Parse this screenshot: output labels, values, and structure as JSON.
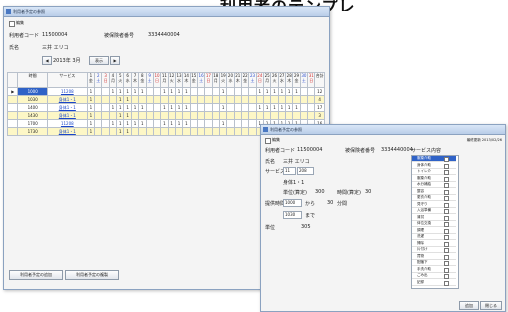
{
  "heading": "利用者のテンプレ",
  "win1": {
    "title": "利用者予定の参照",
    "edit_label": "編集",
    "user_code_label": "利用者コード",
    "user_code": "11500004",
    "insurance_label": "被保険者番号",
    "insurance_no": "3334440004",
    "name_label": "氏名",
    "name": "三井 エリコ",
    "month": "2013年 3月",
    "display_btn": "表示",
    "prev_icon": "chevron-left-icon",
    "next_icon": "chevron-right-icon",
    "col_time": "時間",
    "col_service": "サービス",
    "days": [
      {
        "d": "1",
        "w": "金"
      },
      {
        "d": "2",
        "w": "土"
      },
      {
        "d": "3",
        "w": "日"
      },
      {
        "d": "4",
        "w": "月"
      },
      {
        "d": "5",
        "w": "火"
      },
      {
        "d": "6",
        "w": "水"
      },
      {
        "d": "7",
        "w": "木"
      },
      {
        "d": "8",
        "w": "金"
      },
      {
        "d": "9",
        "w": "土"
      },
      {
        "d": "10",
        "w": "日"
      },
      {
        "d": "11",
        "w": "月"
      },
      {
        "d": "12",
        "w": "火"
      },
      {
        "d": "13",
        "w": "水"
      },
      {
        "d": "14",
        "w": "木"
      },
      {
        "d": "15",
        "w": "金"
      },
      {
        "d": "16",
        "w": "土"
      },
      {
        "d": "17",
        "w": "日"
      },
      {
        "d": "18",
        "w": "月"
      },
      {
        "d": "19",
        "w": "火"
      },
      {
        "d": "20",
        "w": "水"
      },
      {
        "d": "21",
        "w": "木"
      },
      {
        "d": "22",
        "w": "金"
      },
      {
        "d": "23",
        "w": "土"
      },
      {
        "d": "24",
        "w": "日"
      },
      {
        "d": "25",
        "w": "月"
      },
      {
        "d": "26",
        "w": "火"
      },
      {
        "d": "27",
        "w": "水"
      },
      {
        "d": "28",
        "w": "木"
      },
      {
        "d": "29",
        "w": "金"
      },
      {
        "d": "30",
        "w": "土"
      },
      {
        "d": "31",
        "w": "日"
      }
    ],
    "total_col": "合計",
    "rows": [
      {
        "time": "1000",
        "service": "11208",
        "marks": [
          1,
          0,
          0,
          1,
          1,
          1,
          1,
          1,
          0,
          0,
          1,
          1,
          1,
          1,
          0,
          0,
          0,
          0,
          1,
          0,
          0,
          0,
          0,
          1,
          1,
          1,
          1,
          1,
          1,
          0,
          0
        ],
        "total": "12"
      },
      {
        "time": "1030",
        "service": "身体1・1",
        "marks": [
          1,
          0,
          0,
          0,
          1,
          1,
          0,
          0,
          0,
          0,
          0,
          0,
          0,
          0,
          0,
          0,
          0,
          0,
          0,
          0,
          0,
          0,
          0,
          0,
          0,
          0,
          0,
          0,
          0,
          0,
          0
        ],
        "total": "4"
      },
      {
        "time": "1400",
        "service": "身体1・1",
        "marks": [
          1,
          0,
          0,
          1,
          1,
          1,
          1,
          1,
          0,
          0,
          1,
          1,
          1,
          1,
          0,
          0,
          0,
          0,
          1,
          0,
          0,
          0,
          0,
          1,
          1,
          1,
          1,
          1,
          1,
          0,
          0
        ],
        "total": "17"
      },
      {
        "time": "1430",
        "service": "身体1・1",
        "marks": [
          1,
          0,
          0,
          0,
          1,
          1,
          0,
          0,
          0,
          0,
          0,
          0,
          0,
          0,
          0,
          0,
          0,
          0,
          0,
          0,
          0,
          0,
          0,
          0,
          0,
          0,
          0,
          0,
          0,
          0,
          0
        ],
        "total": "3"
      },
      {
        "time": "1700",
        "service": "11208",
        "marks": [
          1,
          0,
          0,
          1,
          1,
          1,
          1,
          1,
          0,
          0,
          1,
          1,
          1,
          1,
          0,
          0,
          0,
          0,
          1,
          0,
          0,
          0,
          0,
          1,
          1,
          1,
          1,
          1,
          1,
          0,
          0
        ],
        "total": "16"
      },
      {
        "time": "1730",
        "service": "身体1・1",
        "marks": [
          1,
          0,
          0,
          0,
          1,
          1,
          0,
          0,
          0,
          0,
          0,
          0,
          0,
          0,
          0,
          0,
          0,
          0,
          0,
          0,
          0,
          0,
          0,
          0,
          0,
          0,
          0,
          0,
          0,
          0,
          0
        ],
        "total": "4"
      }
    ],
    "add_btn": "利用者予定の追加",
    "copy_btn": "利用者予定の複製"
  },
  "win2": {
    "title": "利用者予定の参照",
    "edit_label": "編集",
    "last_update": "最終更新 2013/02/26",
    "user_code_label": "利用者コード",
    "user_code": "11500004",
    "insurance_label": "被保険者番号",
    "insurance_no": "3334440004",
    "name_label": "氏名",
    "name": "三井 エリコ",
    "service_label": "サービス",
    "service_code": "11",
    "service_code2": "208",
    "service_name": "身体1・1",
    "unit_label": "単位(算定)",
    "unit_value": "300",
    "time_label": "時間(算定)",
    "time_value": "30",
    "provide_label": "提供時間",
    "provide_from": "1000",
    "provide_sep": "から",
    "provide_min": "30",
    "provide_min_unit": "分間",
    "provide_to": "1030",
    "provide_to_label": "まで",
    "units_label": "単位",
    "units_value": "305",
    "contents_label": "サービス内容",
    "contents": [
      "服薬介助",
      "身体介助",
      "トイレ介",
      "服薬介助",
      "水分補給",
      "整容",
      "更衣介助",
      "見守り",
      "入浴準備",
      "清拭",
      "体位交換",
      "調理",
      "洗濯",
      "掃除",
      "片付け",
      "買物",
      "配膳下",
      "手洗介助",
      "ごみ出",
      "記録"
    ],
    "ok_btn": "追加",
    "cancel_btn": "閉じる"
  }
}
